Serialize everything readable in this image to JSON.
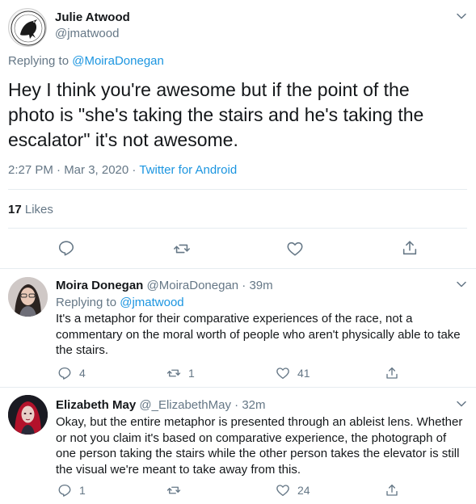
{
  "main_tweet": {
    "author_name": "Julie Atwood",
    "author_handle": "@jmatwood",
    "replying_prefix": "Replying to",
    "replying_to": "@MoiraDonegan",
    "text": "Hey I think you're awesome but if the point of the photo is \"she's taking the stairs and he's taking the escalator\" it's not awesome.",
    "time": "2:27 PM · Mar 3, 2020 · ",
    "source": "Twitter for Android",
    "likes_count": "17",
    "likes_label": "Likes"
  },
  "replies": [
    {
      "name": "Moira Donegan",
      "handle_time": "@MoiraDonegan · 39m",
      "replying_prefix": "Replying to",
      "replying_to": "@jmatwood",
      "text": "It's a metaphor for their comparative experiences of the race, not a commentary on the moral worth of people who aren't physically able to take the stairs.",
      "reply_count": "4",
      "retweet_count": "1",
      "like_count": "41"
    },
    {
      "name": "Elizabeth May",
      "handle_time": "@_ElizabethMay · 32m",
      "text": "Okay, but the entire metaphor is presented through an ableist lens. Whether or not you claim it's based on comparative experience, the photograph of one person taking the stairs while the other person takes the elevator is still the visual we're meant to take away from this.",
      "reply_count": "1",
      "retweet_count": "",
      "like_count": "24"
    }
  ],
  "colors": {
    "text_primary": "#14171a",
    "text_secondary": "#657786",
    "link": "#1b95e0",
    "divider": "#e6ecf0"
  },
  "icons": [
    "raven-logo-avatar",
    "chevron-down-icon",
    "reply-icon",
    "retweet-icon",
    "like-icon",
    "share-icon"
  ]
}
